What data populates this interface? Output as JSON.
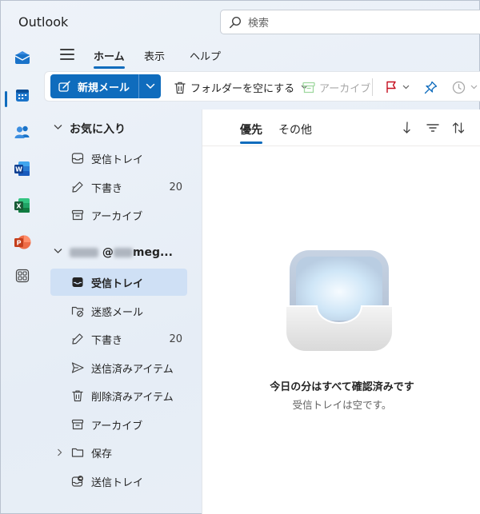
{
  "app": {
    "title": "Outlook"
  },
  "search": {
    "placeholder": "検索"
  },
  "menu": {
    "tabs": [
      "ホーム",
      "表示",
      "ヘルプ"
    ],
    "active_tab": "ホーム"
  },
  "ribbon": {
    "new_mail": "新規メール",
    "empty_folder": "フォルダーを空にする",
    "archive": "アーカイブ"
  },
  "favorites": {
    "header": "お気に入り",
    "items": [
      {
        "name": "受信トレイ",
        "count": ""
      },
      {
        "name": "下書き",
        "count": "20"
      },
      {
        "name": "アーカイブ",
        "count": ""
      }
    ]
  },
  "account": {
    "header_visible": "@",
    "header_suffix": "meg...",
    "items": [
      {
        "name": "受信トレイ",
        "count": "",
        "selected": true
      },
      {
        "name": "迷惑メール",
        "count": ""
      },
      {
        "name": "下書き",
        "count": "20"
      },
      {
        "name": "送信済みアイテム",
        "count": ""
      },
      {
        "name": "削除済みアイテム",
        "count": ""
      },
      {
        "name": "アーカイブ",
        "count": ""
      },
      {
        "name": "保存",
        "count": ""
      },
      {
        "name": "送信トレイ",
        "count": ""
      }
    ]
  },
  "list": {
    "pivots": [
      "優先",
      "その他"
    ],
    "active_pivot": "優先",
    "empty_title": "今日の分はすべて確認済みです",
    "empty_subtitle": "受信トレイは空です。"
  },
  "colors": {
    "accent": "#0f6cbd",
    "selected_bg": "#cfe0f5",
    "flag": "#c50f1f"
  }
}
